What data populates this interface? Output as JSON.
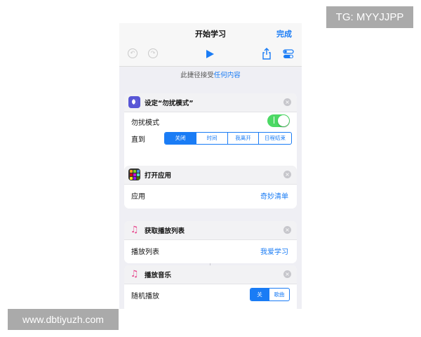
{
  "watermarks": {
    "tg": "TG: MYYJJPP",
    "url": "www.dbtiyuzh.com"
  },
  "nav": {
    "title": "开始学习",
    "done": "完成"
  },
  "toolbar": {
    "undo_icon": "undo-icon",
    "redo_icon": "redo-icon",
    "play_icon": "play-icon",
    "share_icon": "share-icon",
    "settings_icon": "settings-icon"
  },
  "accept": {
    "prefix": "此捷径接受",
    "link": "任何内容"
  },
  "actions": [
    {
      "title": "设定“勿扰模式”",
      "icon": "moon-icon",
      "toggle_row": {
        "label": "勿扰模式",
        "on": true
      },
      "until_row": {
        "label": "直到",
        "options": [
          "关闭",
          "时间",
          "我离开",
          "日程结束"
        ],
        "selected": 0
      }
    },
    {
      "title": "打开应用",
      "icon": "apps-icon",
      "row": {
        "label": "应用",
        "value": "奇妙清单"
      }
    },
    {
      "title": "获取播放列表",
      "icon": "music-note-icon",
      "row": {
        "label": "播放列表",
        "value": "我爱学习"
      }
    },
    {
      "title": "播放音乐",
      "icon": "music-note-icon",
      "shuffle_row": {
        "label": "随机播放",
        "options": [
          "关",
          "歌曲"
        ],
        "selected": 0
      }
    }
  ],
  "colors": {
    "accent": "#1a7cf5",
    "toggle_on": "#4cd964",
    "moon": "#5856d6",
    "music": "#e7458b"
  }
}
